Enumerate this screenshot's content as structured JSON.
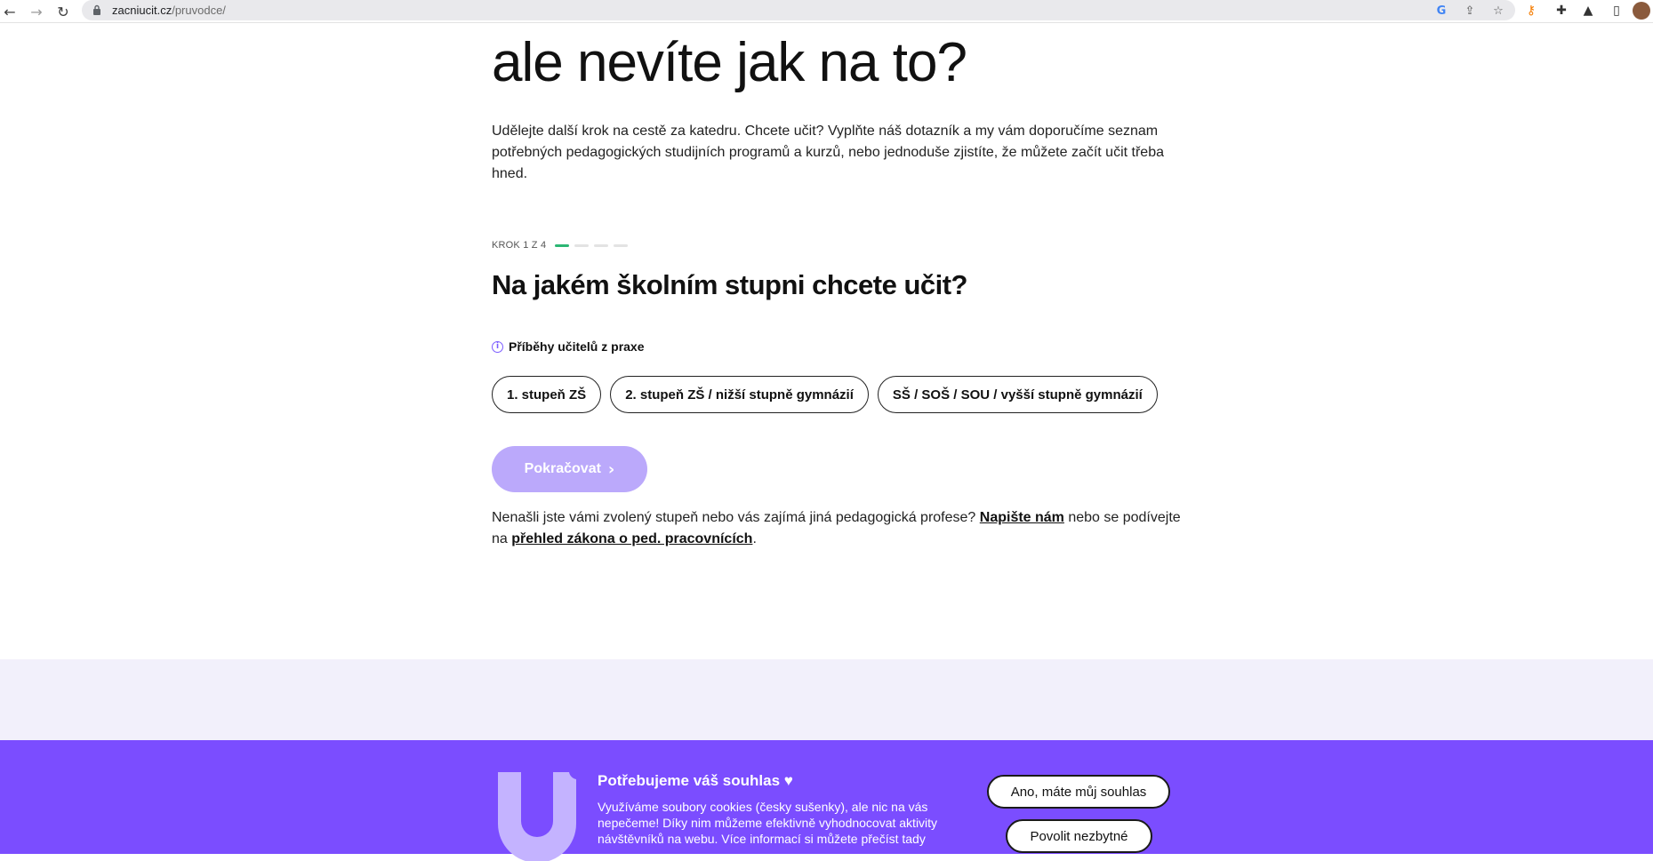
{
  "browser": {
    "url_domain": "zacniucit.cz",
    "url_path": "/pruvodce/",
    "back_icon": "arrow-left-icon",
    "forward_icon": "arrow-right-icon",
    "reload_icon": "reload-icon"
  },
  "hero": {
    "title": "ale nevíte jak na to?",
    "intro": "Udělejte další krok na cestě za katedru. Chcete učit? Vyplňte náš dotazník a my vám doporučíme seznam potřebných pedagogických studijních programů a kurzů, nebo jednoduše zjistíte, že můžete začít učit třeba hned."
  },
  "wizard": {
    "step_label": "KROK 1 Z 4",
    "current_step": 1,
    "total_steps": 4,
    "question": "Na jakém školním stupni chcete učit?",
    "stories_link": "Příběhy učitelů z praxe",
    "options": [
      "1. stupeň ZŠ",
      "2. stupeň ZŠ / nižší stupně gymnázií",
      "SŠ / SOŠ / SOU / vyšší stupně gymnázií"
    ],
    "continue_label": "Pokračovat",
    "footnote": {
      "before": "Nenašli jste vámi zvolený stupeň nebo vás zajímá jiná pedagogická profese? ",
      "link1": "Napište nám",
      "middle": " nebo se podívejte na ",
      "link2": "přehled zákona o ped. pracovnících",
      "after": "."
    }
  },
  "cookie": {
    "title": "Potřebujeme váš souhlas ♥",
    "text": "Využíváme soubory cookies (česky sušenky), ale nic na vás nepečeme! Díky nim můžeme efektivně vyhodnocovat aktivity návštěvníků na webu. Více informací si můžete přečíst tady",
    "accept_label": "Ano, máte můj souhlas",
    "necessary_label": "Povolit nezbytné"
  },
  "colors": {
    "accent": "#7b4dff",
    "button_disabled": "#bba9fb",
    "progress_active": "#2bb673",
    "footer_bg": "#f2f0fb"
  }
}
